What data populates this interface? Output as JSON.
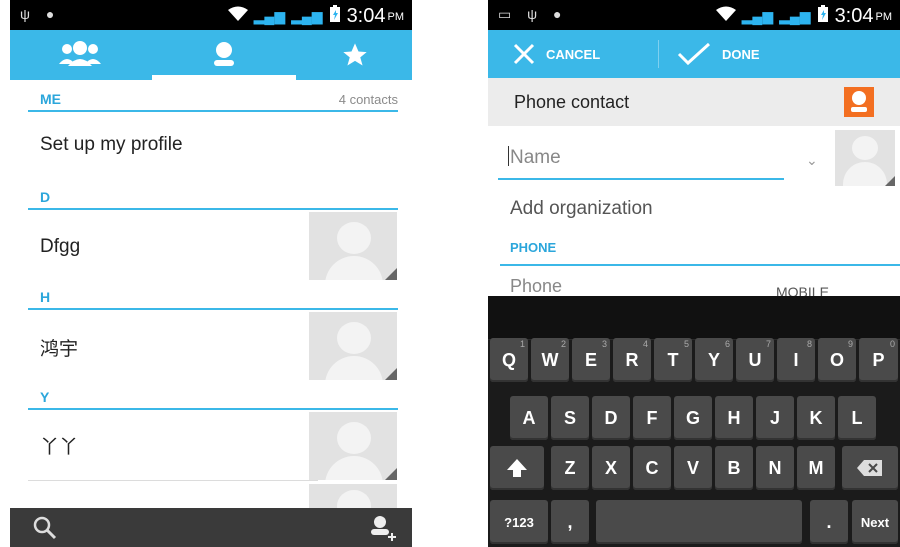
{
  "left_screen": {
    "status": {
      "time": "3:04",
      "ampm": "PM"
    },
    "tabs": [
      "groups-icon",
      "person-icon",
      "star-icon"
    ],
    "sections": [
      {
        "letter": "ME",
        "count": "4 contacts",
        "entry": "Set up my profile"
      },
      {
        "letter": "D",
        "entry": "Dfgg"
      },
      {
        "letter": "H",
        "entry": "鸿宇"
      },
      {
        "letter": "Y",
        "entry": "丫丫"
      }
    ]
  },
  "right_screen": {
    "status": {
      "time": "3:04",
      "ampm": "PM"
    },
    "actionbar": {
      "cancel": "CANCEL",
      "done": "DONE"
    },
    "account_label": "Phone contact",
    "name_placeholder": "Name",
    "organization": "Add organization",
    "phone_header": "PHONE",
    "phone_placeholder": "Phone",
    "phone_type": "MOBILE",
    "keyboard": {
      "row1": [
        "Q",
        "W",
        "E",
        "R",
        "T",
        "Y",
        "U",
        "I",
        "O",
        "P"
      ],
      "row1_nums": [
        "1",
        "2",
        "3",
        "4",
        "5",
        "6",
        "7",
        "8",
        "9",
        "0"
      ],
      "row2": [
        "A",
        "S",
        "D",
        "F",
        "G",
        "H",
        "J",
        "K",
        "L"
      ],
      "row3": [
        "Z",
        "X",
        "C",
        "V",
        "B",
        "N",
        "M"
      ],
      "symbols": "?123",
      "comma": ",",
      "period": ".",
      "next": "Next"
    }
  },
  "colors": {
    "accent": "#3bb8e8",
    "orange": "#f36f21",
    "keyboard": "#1b1b1b",
    "key": "#4a4a4a"
  }
}
